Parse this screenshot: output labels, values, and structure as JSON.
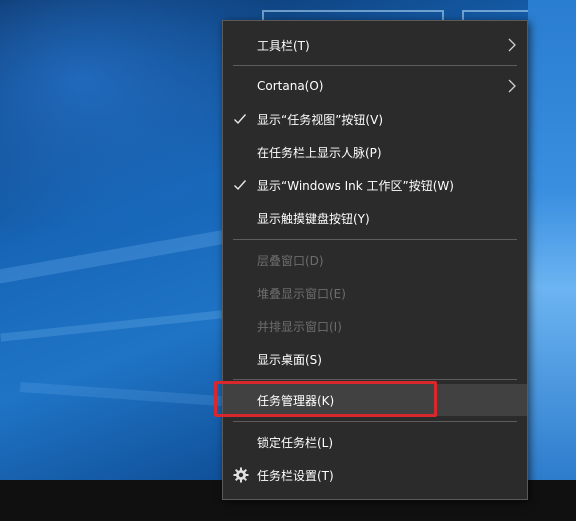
{
  "menu": {
    "items": [
      {
        "label": "工具栏(T)"
      },
      {
        "label": "Cortana(O)"
      },
      {
        "label": "显示“任务视图”按钮(V)"
      },
      {
        "label": "在任务栏上显示人脉(P)"
      },
      {
        "label": "显示“Windows Ink 工作区”按钮(W)"
      },
      {
        "label": "显示触摸键盘按钮(Y)"
      },
      {
        "label": "层叠窗口(D)"
      },
      {
        "label": "堆叠显示窗口(E)"
      },
      {
        "label": "并排显示窗口(I)"
      },
      {
        "label": "显示桌面(S)"
      },
      {
        "label": "任务管理器(K)"
      },
      {
        "label": "锁定任务栏(L)"
      },
      {
        "label": "任务栏设置(T)"
      }
    ]
  },
  "colors": {
    "menu_bg": "#2b2b2b",
    "hover_bg": "#414141",
    "disabled_text": "#6d6d6d",
    "highlight_border": "#d7282e"
  },
  "icons": [
    "check-icon",
    "chevron-right-icon",
    "gear-icon"
  ]
}
